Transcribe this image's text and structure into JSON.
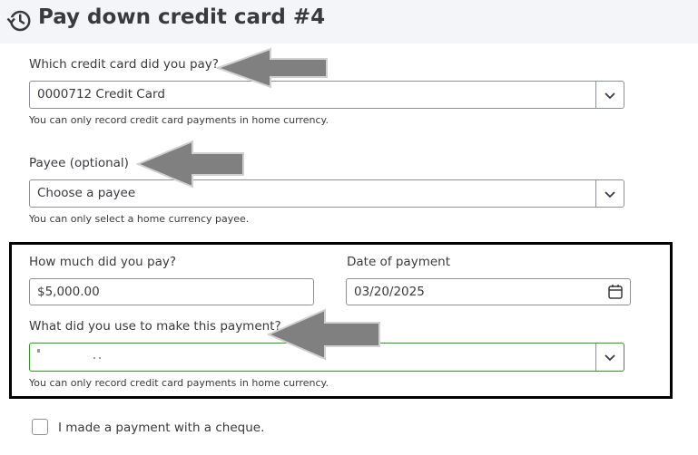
{
  "page": {
    "title": "Pay down credit card #4"
  },
  "icons": {
    "history": "history-icon",
    "chevron": "chevron-down-icon",
    "calendar": "calendar-icon",
    "annotation_arrow": "left-arrow-annotation-icon"
  },
  "credit_card": {
    "label": "Which credit card did you pay?",
    "value": "0000712 Credit Card",
    "hint": "You can only record credit card payments in home currency."
  },
  "payee": {
    "label": "Payee (optional)",
    "placeholder": "Choose a payee",
    "hint": "You can only select a home currency payee."
  },
  "amount": {
    "label": "How much did you pay?",
    "value": "$5,000.00"
  },
  "date": {
    "label": "Date of payment",
    "value": "03/20/2025"
  },
  "payment_account": {
    "label": "What did you use to make this payment?",
    "hint": "You can only record credit card payments in home currency."
  },
  "cheque": {
    "label": "I made a payment with a cheque.",
    "checked": false
  },
  "colors": {
    "header_bg": "#f4f5f8",
    "text": "#393a3d",
    "active_border": "#2ca01c",
    "annotation_arrow": "#808080",
    "frame": "#000000"
  }
}
